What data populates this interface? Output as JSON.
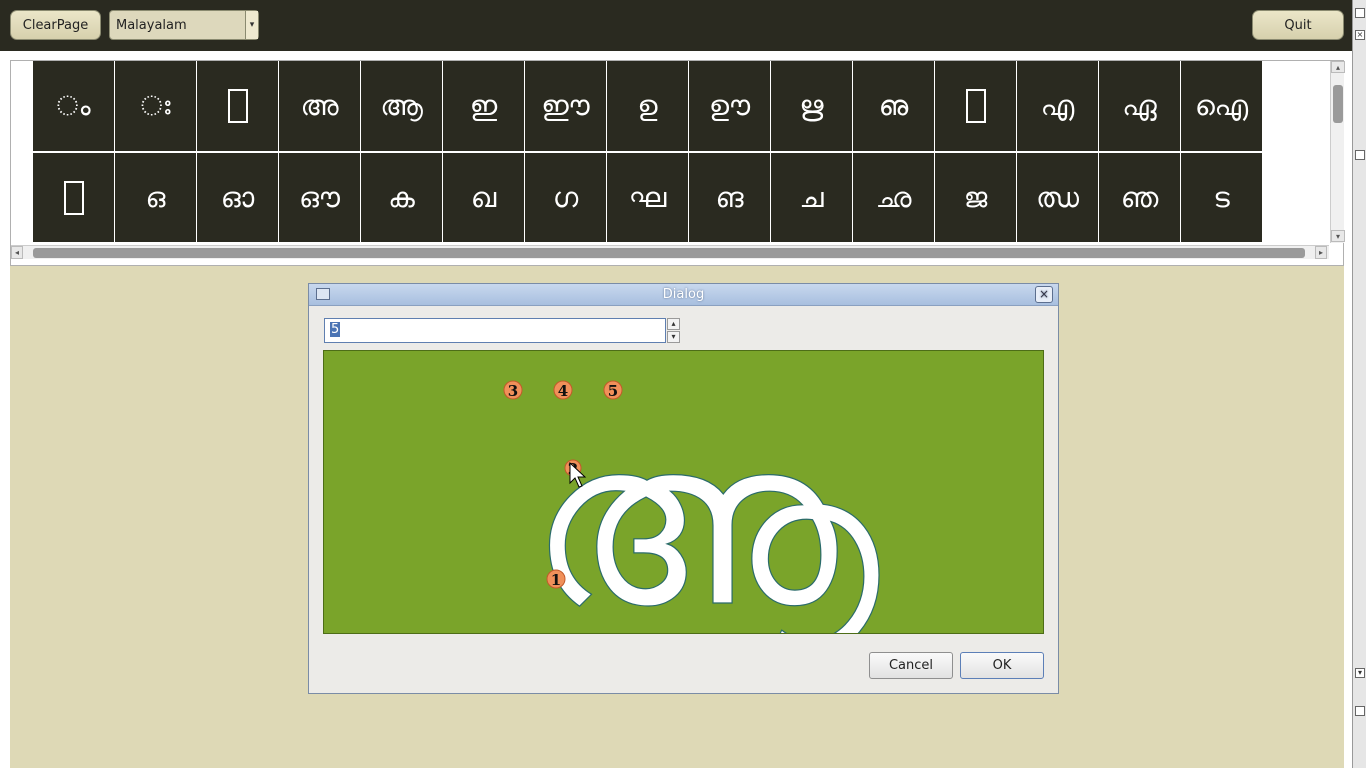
{
  "toolbar": {
    "clear_label": "ClearPage",
    "language_selected": "Malayalam",
    "quit_label": "Quit"
  },
  "grid": {
    "row1": [
      "◌ം",
      "◌ഃ",
      "",
      "അ",
      "ആ",
      "ഇ",
      "ഈ",
      "ഉ",
      "ഊ",
      "ഋ",
      "ഌ",
      "",
      "എ",
      "ഏ",
      "ഐ"
    ],
    "row2": [
      "",
      "ഒ",
      "ഓ",
      "ഔ",
      "ക",
      "ഖ",
      "ഗ",
      "ഘ",
      "ങ",
      "ച",
      "ഛ",
      "ജ",
      "ഝ",
      "ഞ",
      "ട"
    ]
  },
  "dialog": {
    "title": "Dialog",
    "spin_value": "5",
    "glyph": "ആ",
    "stroke_points": [
      "1",
      "2",
      "3",
      "4",
      "5"
    ],
    "cancel_label": "Cancel",
    "ok_label": "OK"
  },
  "colors": {
    "toolbar_bg": "#2a2a20",
    "work_bg": "#ded9b6",
    "canvas_bg": "#7aa42a",
    "marker_fill": "#f0905a"
  }
}
